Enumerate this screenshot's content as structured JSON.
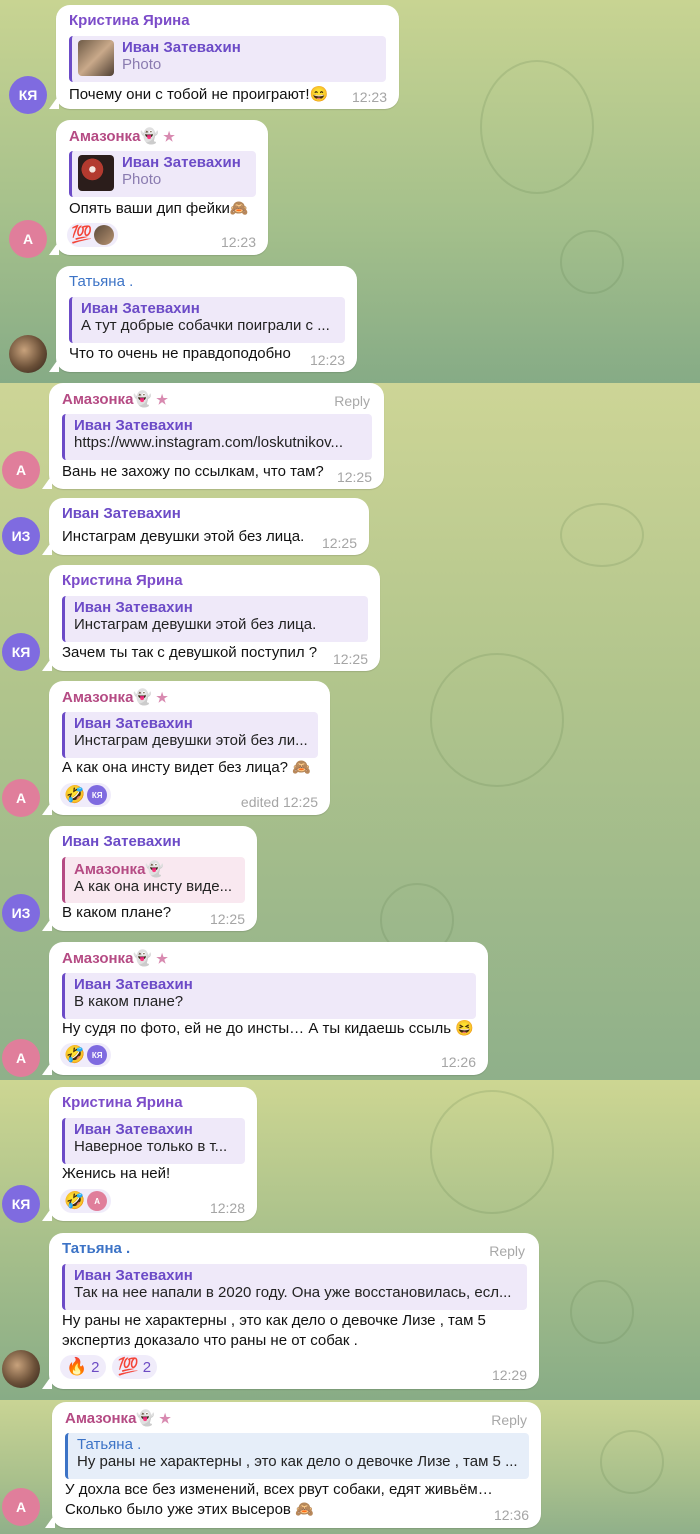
{
  "colors": {
    "kristina": "#7c4cc9",
    "amazonka": "#b54b84",
    "tatyana": "#3c73c6",
    "ivan": "#6c4bc7",
    "quote_bg_purple": "#efe9f9",
    "quote_bg_pink": "#f9e8f0",
    "quote_bg_blue": "#e6eef9",
    "avatar_purple": "#7f6be0",
    "avatar_pink": "#e07e9b"
  },
  "reply_label": "Reply",
  "messages": [
    {
      "sender": "Кристина Ярина",
      "avatar": "КЯ",
      "quote_name": "Иван Затевахин",
      "quote_text": "Photo",
      "text": "Почему они с тобой не проиграют!😄",
      "time": "12:23"
    },
    {
      "sender": "Амазонка👻",
      "star": "★",
      "avatar": "А",
      "quote_name": "Иван Затевахин",
      "quote_text": "Photo",
      "text": "Опять ваши дип фейки🙈",
      "time": "12:23",
      "reactions": [
        "💯"
      ]
    },
    {
      "sender": "Татьяна .",
      "avatar": "photo",
      "quote_name": "Иван Затевахин",
      "quote_text": "А тут добрые собачки поиграли с ...",
      "text": "Что то очень не правдоподобно",
      "time": "12:23"
    },
    {
      "sender": "Амазонка👻",
      "star": "★",
      "avatar": "А",
      "quote_name": "Иван Затевахин",
      "quote_text": "https://www.instagram.com/loskutnikov...",
      "text": "Вань не захожу по ссылкам, что там?",
      "time": "12:25"
    },
    {
      "sender": "Иван Затевахин",
      "avatar": "ИЗ",
      "text": "Инстаграм девушки этой без лица.",
      "time": "12:25"
    },
    {
      "sender": "Кристина Ярина",
      "avatar": "КЯ",
      "quote_name": "Иван Затевахин",
      "quote_text": "Инстаграм девушки этой без лица.",
      "text": "Зачем ты так с девушкой поступил ?",
      "time": "12:25"
    },
    {
      "sender": "Амазонка👻",
      "star": "★",
      "avatar": "А",
      "quote_name": "Иван Затевахин",
      "quote_text": "Инстаграм девушки этой без ли...",
      "text": "А как она инсту видет  без лица? 🙈",
      "time": "edited 12:25",
      "reactions": [
        "🤣",
        "КЯ"
      ]
    },
    {
      "sender": "Иван Затевахин",
      "avatar": "ИЗ",
      "quote_name": "Амазонка👻",
      "quote_text": "А как она инсту виде...",
      "text": "В каком плане?",
      "time": "12:25"
    },
    {
      "sender": "Амазонка👻",
      "star": "★",
      "avatar": "А",
      "quote_name": "Иван Затевахин",
      "quote_text": "В каком плане?",
      "text": "Ну судя по фото, ей не до инсты… А ты кидаешь  ссыль 😆",
      "time": "12:26",
      "reactions": [
        "🤣",
        "КЯ"
      ]
    },
    {
      "sender": "Кристина Ярина",
      "avatar": "КЯ",
      "quote_name": "Иван Затевахин",
      "quote_text": "Наверное только в т...",
      "text": "Женись на ней!",
      "time": "12:28",
      "reactions": [
        "🤣",
        "А"
      ]
    },
    {
      "sender": "Татьяна .",
      "avatar": "photo",
      "quote_name": "Иван Затевахин",
      "quote_text": "Так на нее напали в 2020 году. Она уже восстановилась, есл...",
      "text_lines": [
        "Ну раны не характерны , это как дело о девочке Лизе , там 5",
        "экспертиз доказало что раны не от собак ."
      ],
      "time": "12:29",
      "reactions": [
        {
          "emoji": "🔥",
          "count": "2"
        },
        {
          "emoji": "💯",
          "count": "2"
        }
      ]
    },
    {
      "sender": "Амазонка👻",
      "star": "★",
      "avatar": "А",
      "quote_name": "Татьяна .",
      "quote_text": "Ну раны не характерны , это как дело о девочке Лизе , там 5 ...",
      "text_lines": [
        "У дохла все без изменений,  всех рвут собаки, едят живьём…",
        "Сколько было уже этих высеров 🙈"
      ],
      "time": "12:36"
    }
  ]
}
